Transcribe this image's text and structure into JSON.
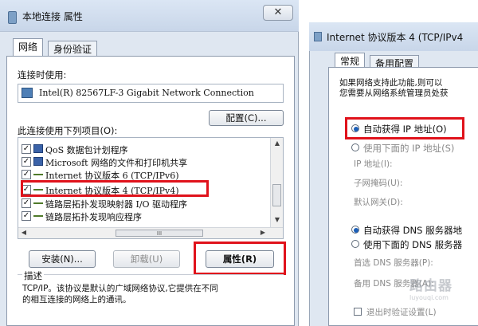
{
  "left_window": {
    "title": "本地连接 属性",
    "close_label": "✕",
    "tabs": [
      {
        "label": "网络",
        "active": true
      },
      {
        "label": "身份验证",
        "active": false
      }
    ],
    "connect_using_label": "连接时使用:",
    "adapter_name": "Intel(R) 82567LF-3 Gigabit Network Connection",
    "configure_button": "配置(C)...",
    "items_label": "此连接使用下列项目(O):",
    "items": [
      {
        "label": "QoS 数据包计划程序",
        "checked": true,
        "icon": "network-service-icon"
      },
      {
        "label": "Microsoft 网络的文件和打印机共享",
        "checked": true,
        "icon": "network-service-icon"
      },
      {
        "label": "Internet 协议版本 6 (TCP/IPv6)",
        "checked": true,
        "icon": "protocol-icon"
      },
      {
        "label": "Internet 协议版本 4 (TCP/IPv4)",
        "checked": true,
        "icon": "protocol-icon",
        "highlighted": true
      },
      {
        "label": "链路层拓扑发现映射器 I/O 驱动程序",
        "checked": true,
        "icon": "protocol-icon"
      },
      {
        "label": "链路层拓扑发现响应程序",
        "checked": true,
        "icon": "protocol-icon"
      }
    ],
    "hscroll_thumb_label": "III",
    "install_button": "安装(N)...",
    "uninstall_button": "卸载(U)",
    "properties_button": "属性(R)",
    "description_label": "描述",
    "description_line1": "TCP/IP。该协议是默认的广域网络协议,它提供在不同",
    "description_line2": "的相互连接的网络上的通讯。"
  },
  "right_window": {
    "title": "Internet 协议版本 4 (TCP/IPv4",
    "tabs": [
      {
        "label": "常规",
        "active": true
      },
      {
        "label": "备用配置",
        "active": false
      }
    ],
    "info_line1": "如果网络支持此功能,则可以",
    "info_line2": "您需要从网络系统管理员处获",
    "auto_ip_label": "自动获得 IP 地址(O)",
    "manual_ip_label": "使用下面的 IP 地址(S)",
    "ip_address_label": "IP 地址(I):",
    "subnet_label": "子网掩码(U):",
    "gateway_label": "默认网关(D):",
    "auto_dns_label": "自动获得 DNS 服务器地",
    "manual_dns_label": "使用下面的 DNS 服务器",
    "preferred_dns_label": "首选 DNS 服务器(P):",
    "alternate_dns_label": "备用 DNS 服务器(A):",
    "validate_label": "退出时验证设置(L)"
  },
  "watermark": {
    "text": "路由器",
    "subtext": "luyouqi.com"
  },
  "colors": {
    "highlight_red": "#e0121b",
    "window_frame": "#dfe7f1",
    "radio_selected": "#1c5fb8"
  }
}
